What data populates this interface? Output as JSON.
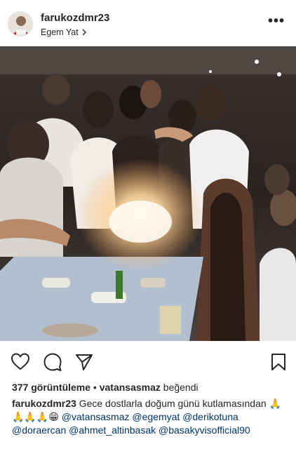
{
  "post": {
    "username": "farukozdmr23",
    "location": "Egem Yat",
    "more_label": "•••"
  },
  "stats": {
    "views_count": "377 görüntüleme",
    "separator": "•",
    "liked_by_user": "vatansasmaz",
    "liked_suffix": "beğendi"
  },
  "caption": {
    "author": "farukozdmr23",
    "text_line1": "Gece dostlarla doğum günü",
    "text_line2": "kutlamasından 🙏🙏🙏🙏😁",
    "mentions": [
      "@vatansasmaz",
      "@egemyat",
      "@derikotuna",
      "@doraercan",
      "@ahmet_altinbasak",
      "@basakyvisofficial90"
    ]
  },
  "icons": {
    "like": "heart-icon",
    "comment": "comment-icon",
    "share": "share-icon",
    "save": "bookmark-icon"
  },
  "colors": {
    "text": "#262626",
    "mention": "#003569",
    "secondary": "#8e8e8e"
  }
}
